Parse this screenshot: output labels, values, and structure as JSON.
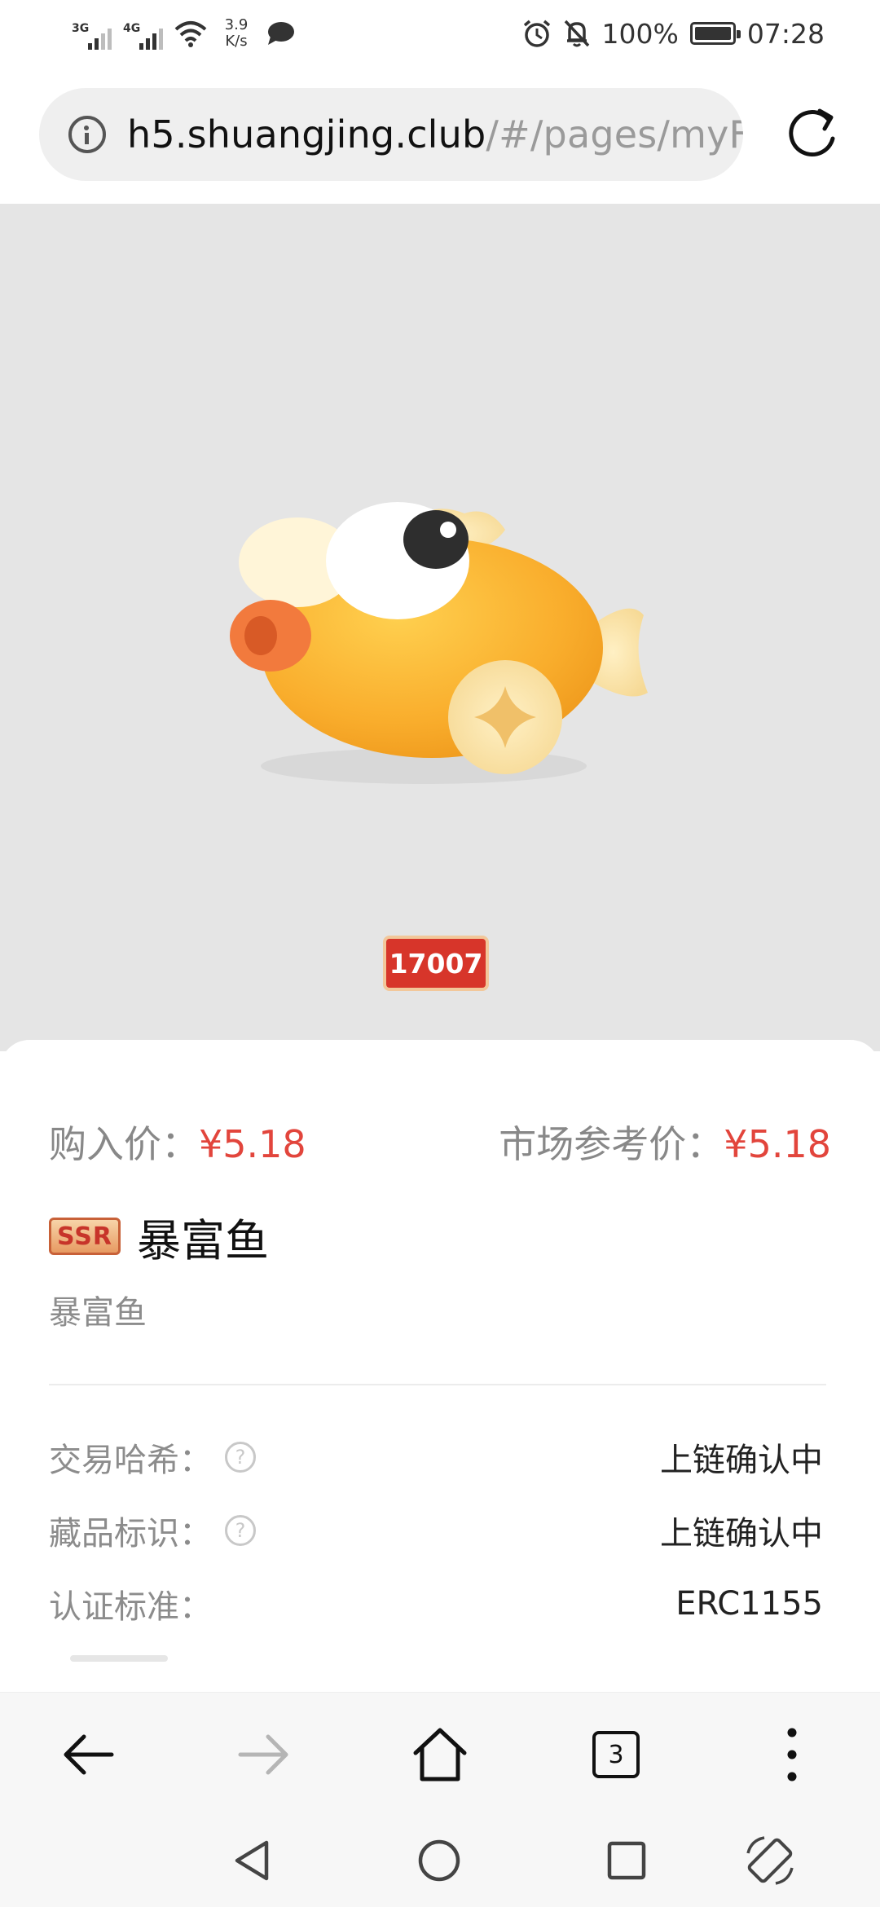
{
  "status_bar": {
    "network1": "3G",
    "network2": "4G",
    "speed_value": "3.9",
    "speed_unit": "K/s",
    "battery": "100%",
    "time": "07:28"
  },
  "browser": {
    "url_host": "h5.shuangjing.club",
    "url_path": "/#/pages/myFr",
    "tab_count": "3"
  },
  "item": {
    "serial": "17007",
    "purchase_price_label": "购入价：",
    "purchase_price": "¥5.18",
    "market_price_label": "市场参考价：",
    "market_price": "¥5.18",
    "rarity": "SSR",
    "title": "暴富鱼",
    "subtitle": "暴富鱼",
    "details": [
      {
        "label": "交易哈希：",
        "value": "上链确认中",
        "help": "?"
      },
      {
        "label": "藏品标识：",
        "value": "上链确认中",
        "help": "?"
      },
      {
        "label": "认证标准：",
        "value": "ERC1155"
      }
    ]
  },
  "colors": {
    "price_red": "#e2453c",
    "hero_bg": "#e5e5e5",
    "badge_red": "#d7352a"
  }
}
